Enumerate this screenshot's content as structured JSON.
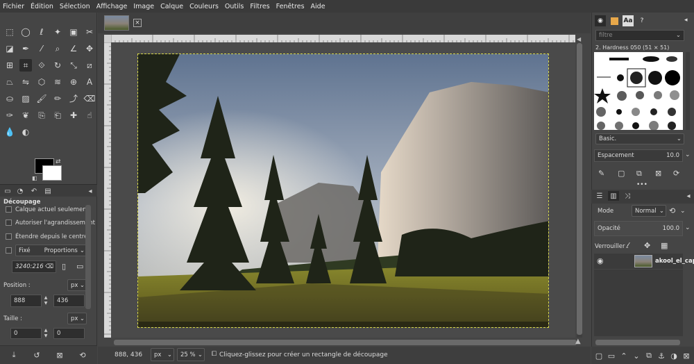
{
  "menubar": [
    "Fichier",
    "Édition",
    "Sélection",
    "Affichage",
    "Image",
    "Calque",
    "Couleurs",
    "Outils",
    "Filtres",
    "Fenêtres",
    "Aide"
  ],
  "tool_options": {
    "title": "Découpage",
    "current_layer_only": "Calque actuel seulement",
    "allow_growing": "Autoriser l'agrandissement",
    "expand_from_center": "Étendre depuis le centre",
    "fixed_label": "Fixé",
    "fixed_mode": "Proportions",
    "ratio_value": "3240:216",
    "position_label": "Position :",
    "position_unit": "px",
    "position_x": "888",
    "position_y": "436",
    "size_label": "Taille :",
    "size_unit": "px",
    "size_w": "0",
    "size_h": "0"
  },
  "status": {
    "coords": "888, 436",
    "unit": "px",
    "zoom": "25 %",
    "message": "Cliquez-glissez pour créer un rectangle de découpage"
  },
  "brushes": {
    "filter_placeholder": "filtre",
    "current_brush": "2. Hardness 050 (51 × 51)",
    "preset": "Basic.",
    "spacing_label": "Espacement",
    "spacing_value": "10.0"
  },
  "layers": {
    "mode_label": "Mode",
    "mode_value": "Normal",
    "opacity_label": "Opacité",
    "opacity_value": "100.0",
    "lock_label": "Verrouiller :",
    "layer_name": "akool_el_cap.j"
  },
  "icons": {
    "tools": [
      "rect-select",
      "ellipse-select",
      "free-select",
      "fuzzy-select",
      "by-color-select",
      "scissors",
      "foreground-select",
      "paths",
      "color-picker",
      "zoom",
      "measure",
      "move",
      "align",
      "crop",
      "unified-transform",
      "rotate",
      "scale",
      "shear",
      "perspective",
      "flip",
      "cage",
      "warp",
      "handle-transform",
      "text",
      "bucket-fill",
      "gradient",
      "paintbrush",
      "pencil",
      "airbrush",
      "eraser",
      "ink",
      "mypaint",
      "clone",
      "perspective-clone",
      "heal",
      "smudge",
      "blur",
      "dodge-burn"
    ]
  }
}
